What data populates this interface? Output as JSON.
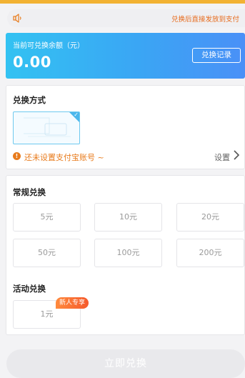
{
  "notice": {
    "text": "兑换后直接发放到支付"
  },
  "balance": {
    "label": "当前可兑换余额（元）",
    "amount": "0.00",
    "records_button": "兑换记录"
  },
  "exchange_method": {
    "title": "兑换方式",
    "warning": "还未设置支付宝账号 ~",
    "settings_label": "设置"
  },
  "regular": {
    "title": "常规兑换",
    "options": [
      "5元",
      "10元",
      "20元",
      "50元",
      "100元",
      "200元"
    ]
  },
  "activity": {
    "title": "活动兑换",
    "option": "1元",
    "badge": "新人专享"
  },
  "submit": {
    "label": "立即兑换"
  },
  "colors": {
    "top_bar": "#f2b233",
    "accent_orange": "#e87b1c",
    "balance_gradient_start": "#33c2f2",
    "balance_gradient_end": "#4a90f7"
  }
}
